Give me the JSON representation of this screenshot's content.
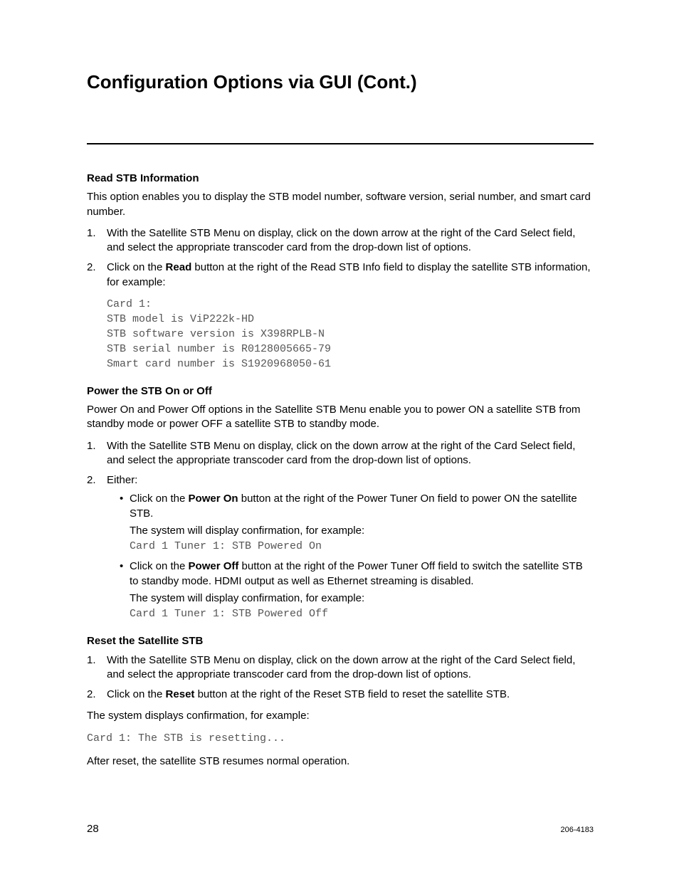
{
  "title": "Configuration Options via GUI (Cont.)",
  "section1": {
    "heading": "Read STB Information",
    "intro": "This option enables you to display the STB model number, software version, serial number, and smart card number.",
    "step1": "With the Satellite STB Menu on display, click on the down arrow at the right of the Card Select field, and select the appropriate transcoder card from the drop-down list of options.",
    "step2_a": "Click on the ",
    "step2_bold": "Read",
    "step2_b": " button at the right of the Read STB Info field to display the satellite STB information, for example:",
    "code": "Card 1:\nSTB model is ViP222k-HD\nSTB software version is X398RPLB-N\nSTB serial number is R0128005665-79\nSmart card number is S1920968050-61"
  },
  "section2": {
    "heading": "Power the STB On or Off",
    "intro": "Power On and Power Off options in the Satellite STB Menu enable you to power ON a satellite STB from standby mode or power OFF a satellite STB to standby mode.",
    "step1": "With the Satellite STB Menu on display, click on the down arrow at the right of the Card Select field, and select the appropriate transcoder card from the drop-down list of options.",
    "step2": "Either:",
    "bullet1_a": "Click on the ",
    "bullet1_bold": "Power On",
    "bullet1_b": " button at the right of the Power Tuner On field to power ON the satellite STB.",
    "bullet1_note": "The system will display confirmation, for example:",
    "bullet1_code": "Card 1 Tuner 1: STB Powered On",
    "bullet2_a": "Click on the ",
    "bullet2_bold": "Power Off",
    "bullet2_b": " button at the right of the Power Tuner Off field to switch the satellite STB to standby mode. HDMI output as well as Ethernet streaming is disabled.",
    "bullet2_note": "The system will display confirmation, for example:",
    "bullet2_code": "Card 1 Tuner 1: STB Powered Off"
  },
  "section3": {
    "heading": "Reset the Satellite STB",
    "step1": "With the Satellite STB Menu on display, click on the down arrow at the right of the Card Select field, and select the appropriate transcoder card from the drop-down list of options.",
    "step2_a": "Click on the ",
    "step2_bold": "Reset",
    "step2_b": " button at the right of the Reset STB field to reset the satellite STB.",
    "confirm": "The system displays confirmation, for example:",
    "code": "Card 1: The STB is resetting...",
    "after": "After reset, the satellite STB resumes normal operation."
  },
  "footer": {
    "page": "28",
    "docid": "206-4183"
  }
}
